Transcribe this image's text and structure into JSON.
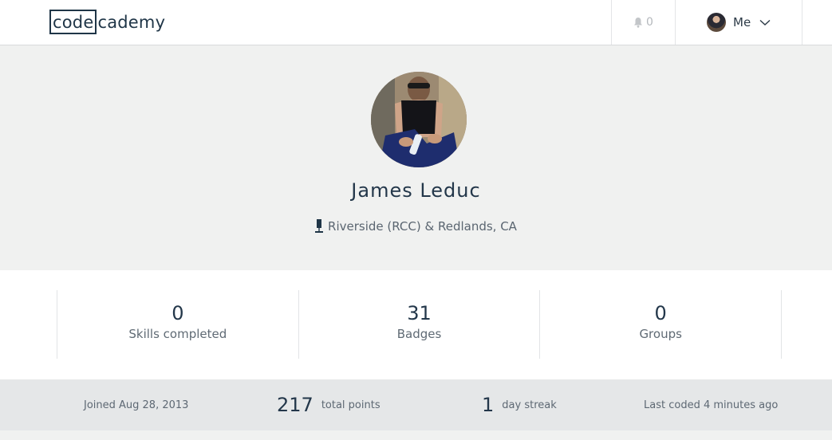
{
  "header": {
    "logo_boxed": "code",
    "logo_rest": "cademy",
    "notifications_count": "0",
    "me_label": "Me"
  },
  "profile": {
    "name": "James Leduc",
    "location": "Riverside (RCC) & Redlands, CA"
  },
  "stats": [
    {
      "value": "0",
      "label": "Skills completed"
    },
    {
      "value": "31",
      "label": "Badges"
    },
    {
      "value": "0",
      "label": "Groups"
    }
  ],
  "activity": {
    "joined": "Joined Aug 28, 2013",
    "points_value": "217",
    "points_label": "total points",
    "streak_value": "1",
    "streak_label": "day streak",
    "last_coded": "Last coded 4 minutes ago"
  },
  "icons": {
    "notifications": "bell-icon",
    "location": "map-pin-icon",
    "menu": "chevron-down-icon"
  },
  "colors": {
    "brand": "#1f3547",
    "banner_bg": "#f0f1f0",
    "strip_bg": "#e5e7e8"
  }
}
